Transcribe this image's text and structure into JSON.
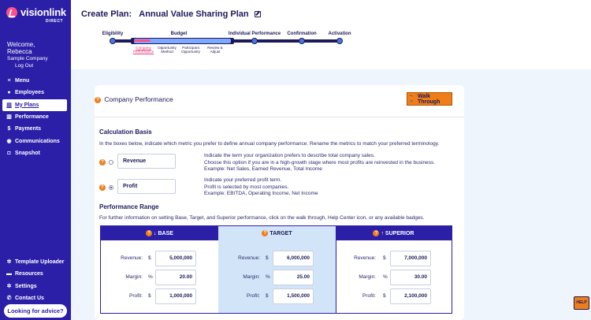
{
  "brand": {
    "name": "visionlink",
    "sub": "DIRECT"
  },
  "user": {
    "welcome": "Welcome,",
    "name": "Rebecca",
    "company": "Sample Company",
    "logout": "Log Out"
  },
  "nav": {
    "top": [
      {
        "label": "Menu",
        "icon": "menu-icon"
      },
      {
        "label": "Employees",
        "icon": "user-icon"
      },
      {
        "label": "My Plans",
        "icon": "plans-icon"
      },
      {
        "label": "Performance",
        "icon": "chart-icon"
      },
      {
        "label": "Payments",
        "icon": "dollar-icon"
      },
      {
        "label": "Communications",
        "icon": "broadcast-icon"
      },
      {
        "label": "Snapshot",
        "icon": "camera-icon"
      }
    ],
    "bottom": [
      {
        "label": "Template Uploader",
        "icon": "gear-icon"
      },
      {
        "label": "Resources",
        "icon": "folder-icon"
      },
      {
        "label": "Settings",
        "icon": "gear-icon"
      },
      {
        "label": "Contact Us",
        "icon": "phone-icon"
      }
    ],
    "advice": "Looking for advice?"
  },
  "page": {
    "title": "Create Plan:",
    "plan_name": "Annual Value Sharing Plan"
  },
  "steps": {
    "main": [
      "Eligibility",
      "Budget",
      "Individual Performance",
      "Confirmation",
      "Activation"
    ],
    "sub": [
      "Company\nPerformance",
      "Opportunity\nMethod",
      "Participant\nOpportunity",
      "Review &\nAdjust"
    ]
  },
  "card": {
    "title": "Company Performance",
    "walk_through": "Walk Through",
    "calc_heading": "Calculation Basis",
    "calc_desc": "In the boxes below, indicate which metric you prefer to define annual company performance. Rename the metrics to match your preferred terminology.",
    "options": [
      {
        "value": "Revenue",
        "selected": false,
        "lines": [
          "Indicate the term your organization prefers to describe total company sales.",
          "Choose this option if you are in a high-growth stage where most profits are reinvested in the business.",
          "Example: Net Sales, Earned Revenue, Total Income"
        ]
      },
      {
        "value": "Profit",
        "selected": true,
        "lines": [
          "Indicate your preferred profit term.",
          "Profit is selected by most companies.",
          "Example: EBITDA, Operating Income, Net Income"
        ]
      }
    ],
    "range_heading": "Performance Range",
    "range_desc": "For further information on setting Base, Target, and Superior performance, click on the walk through, Help Center icon, or any available badges."
  },
  "perf": {
    "columns": [
      {
        "header": "↓ BASE",
        "revenue": "5,000,000",
        "margin": "20.00",
        "profit": "1,000,000"
      },
      {
        "header": "TARGET",
        "revenue": "6,000,000",
        "margin": "25.00",
        "profit": "1,500,000"
      },
      {
        "header": "↑ SUPERIOR",
        "revenue": "7,000,000",
        "margin": "30.00",
        "profit": "2,100,000"
      }
    ],
    "labels": {
      "revenue": "Revenue:",
      "margin": "Margin:",
      "profit": "Profit:"
    },
    "units": {
      "dollar": "$",
      "percent": "%"
    }
  },
  "help": "HELP",
  "colors": {
    "sidebar": "#2b1fa8",
    "accent": "#ef7d1a",
    "highlight": "#ff4f8b",
    "target_bg": "#d2e5f8"
  }
}
